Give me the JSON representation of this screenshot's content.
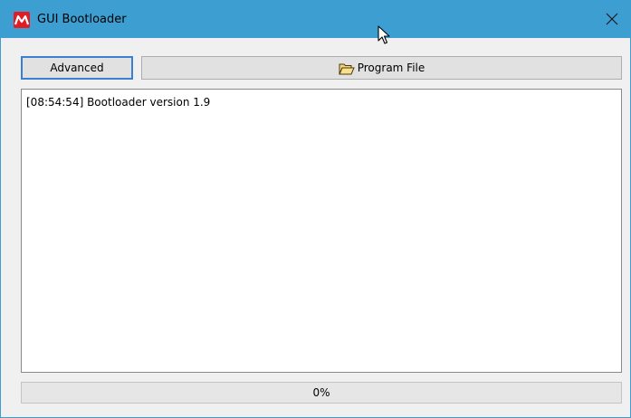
{
  "window": {
    "title": "GUI Bootloader",
    "app_icon": "microchip-logo-icon",
    "close_icon": "close-icon",
    "titlebar_color": "#3c9ed1"
  },
  "toolbar": {
    "advanced_label": "Advanced",
    "program_label": "Program File",
    "program_icon": "open-folder-icon"
  },
  "log": {
    "lines": [
      "[08:54:54] Bootloader version 1.9"
    ]
  },
  "progress": {
    "value": 0,
    "label": "0%"
  }
}
